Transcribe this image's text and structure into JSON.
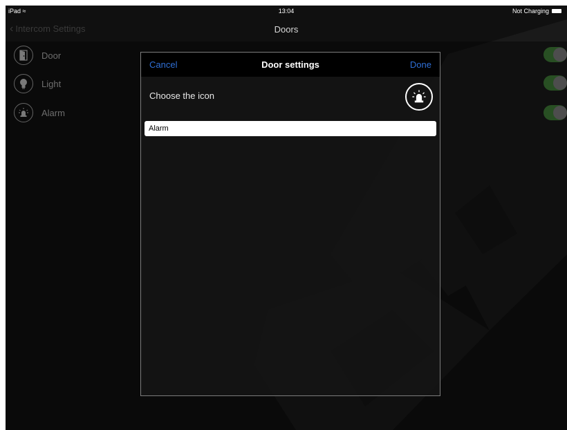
{
  "status_bar": {
    "device": "iPad",
    "time": "13:04",
    "battery_text": "Not Charging"
  },
  "nav": {
    "back_label": "Intercom Settings",
    "title": "Doors"
  },
  "list": {
    "items": [
      {
        "label": "Door",
        "icon": "door-icon",
        "enabled": true
      },
      {
        "label": "Light",
        "icon": "lightbulb-icon",
        "enabled": true
      },
      {
        "label": "Alarm",
        "icon": "alarm-icon",
        "enabled": true
      }
    ]
  },
  "modal": {
    "cancel_label": "Cancel",
    "title": "Door settings",
    "done_label": "Done",
    "choose_label": "Choose the icon",
    "selected_icon": "alarm-icon",
    "name_value": "Alarm"
  },
  "colors": {
    "accent": "#2f6fd6",
    "toggle_on": "#3e7a36",
    "background": "#101010"
  }
}
